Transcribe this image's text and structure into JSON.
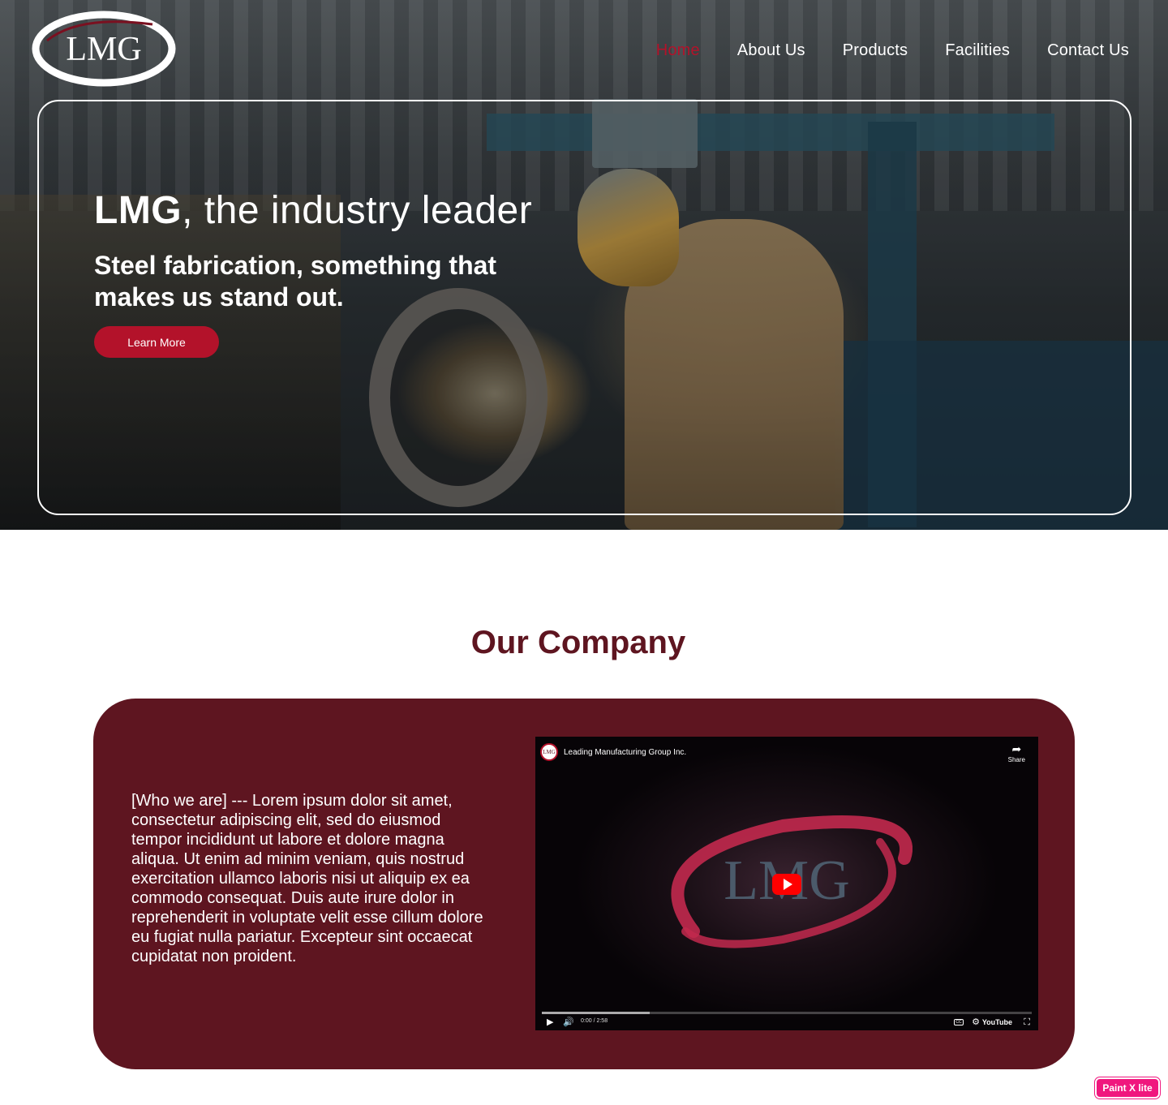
{
  "brand": {
    "logo_text": "LMG",
    "accent_color": "#b3122a",
    "dark_color": "#5e1520"
  },
  "nav": {
    "items": [
      {
        "label": "Home",
        "active": true
      },
      {
        "label": "About Us",
        "active": false
      },
      {
        "label": "Products",
        "active": false
      },
      {
        "label": "Facilities",
        "active": false
      },
      {
        "label": "Contact Us",
        "active": false
      }
    ]
  },
  "hero": {
    "title_bold": "LMG",
    "title_rest": ", the industry leader",
    "subtitle": "Steel fabrication, something that makes us stand out.",
    "cta_label": "Learn More"
  },
  "company": {
    "title": "Our Company",
    "body": "[Who we are] --- Lorem ipsum dolor sit amet, consectetur adipiscing elit, sed do eiusmod tempor incididunt ut labore et dolore magna aliqua. Ut enim ad minim veniam, quis nostrud exercitation ullamco laboris nisi ut aliquip ex ea commodo consequat. Duis aute irure dolor in reprehenderit in voluptate velit esse cillum dolore eu fugiat nulla pariatur. Excepteur sint occaecat cupidatat non proident."
  },
  "video": {
    "channel_avatar_text": "LMG",
    "title": "Leading Manufacturing Group Inc.",
    "share_label": "Share",
    "logo_text": "LMG",
    "time": "0:00 / 2:58",
    "progress": 0.22,
    "youtube_label": "YouTube",
    "cc_label": "CC"
  },
  "badge": {
    "label": "Paint X lite"
  }
}
